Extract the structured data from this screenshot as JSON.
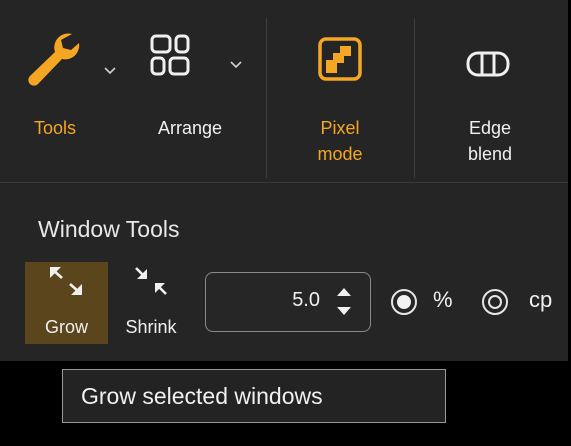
{
  "colors": {
    "accent": "#F5A623",
    "panel": "#252525",
    "selected": "#5A451C",
    "text": "#F0F0F0"
  },
  "toolbar": {
    "tools": {
      "label": "Tools",
      "icon": "wrench-icon"
    },
    "arrange": {
      "label": "Arrange",
      "icon": "arrange-icon"
    },
    "pixel_mode": {
      "label_line1": "Pixel",
      "label_line2": "mode",
      "icon": "pixel-mode-icon"
    },
    "edge_blend": {
      "label_line1": "Edge",
      "label_line2": "blend",
      "icon": "edge-blend-icon"
    }
  },
  "window_tools": {
    "title": "Window Tools",
    "grow": {
      "label": "Grow",
      "icon": "grow-icon",
      "selected": true
    },
    "shrink": {
      "label": "Shrink",
      "icon": "shrink-icon"
    },
    "amount": {
      "value": "5.0"
    },
    "unit_percent": {
      "label": "%",
      "selected": true
    },
    "unit_cp": {
      "label": "cp",
      "selected": false
    }
  },
  "tooltip": {
    "text": "Grow selected windows"
  }
}
